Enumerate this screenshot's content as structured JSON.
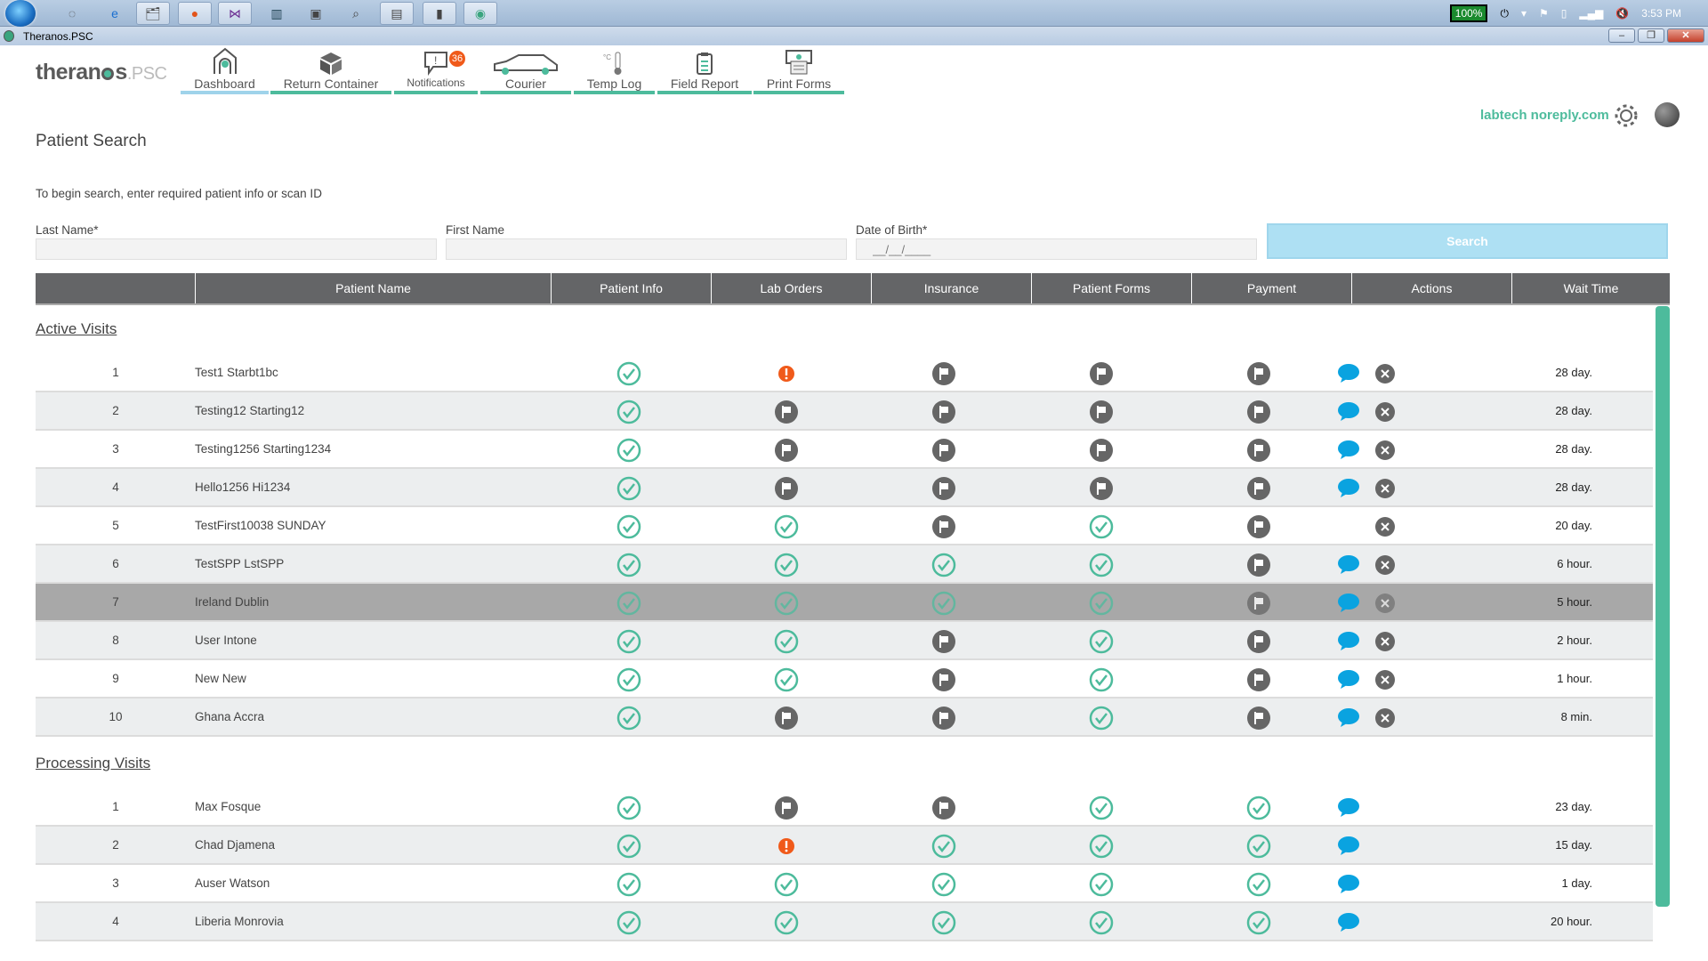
{
  "taskbar": {
    "battery": "100%",
    "clock": "3:53 PM"
  },
  "window": {
    "title": "Theranos.PSC"
  },
  "brand": {
    "name": "theranos",
    "suffix": "PSC"
  },
  "nav": {
    "tabs": [
      {
        "label": "Dashboard",
        "icon": "home-icon",
        "active": true
      },
      {
        "label": "Return Container",
        "icon": "box-icon"
      },
      {
        "label": "Notifications",
        "icon": "speech-bubble-icon",
        "badge": "36"
      },
      {
        "label": "Courier",
        "icon": "car-icon"
      },
      {
        "label": "Temp Log",
        "icon": "thermometer-icon"
      },
      {
        "label": "Field Report",
        "icon": "clipboard-icon"
      },
      {
        "label": "Print Forms",
        "icon": "printer-icon"
      }
    ],
    "user": "labtech noreply.com"
  },
  "search": {
    "title": "Patient Search",
    "hint": "To begin search, enter required patient info or scan ID",
    "last_name_label": "Last Name*",
    "first_name_label": "First Name",
    "dob_label": "Date of Birth*",
    "dob_placeholder": "__/__/____",
    "button": "Search"
  },
  "table": {
    "columns": [
      "",
      "Patient Name",
      "Patient Info",
      "Lab Orders",
      "Insurance",
      "Patient Forms",
      "Payment",
      "Actions",
      "Wait Time"
    ]
  },
  "colors": {
    "accent": "#4dbb9c",
    "alert": "#f05a1a",
    "chat": "#0aa3e0",
    "flag": "#666666",
    "header": "#646567"
  },
  "sections": [
    {
      "title": "Active Visits",
      "rows": [
        {
          "num": "1",
          "name": "Test1 Starbt1bc",
          "status": [
            "check",
            "alert",
            "flag",
            "flag",
            "flag"
          ],
          "chat": true,
          "cancel": true,
          "wait": "28 day."
        },
        {
          "num": "2",
          "name": "Testing12 Starting12",
          "status": [
            "check",
            "flag",
            "flag",
            "flag",
            "flag"
          ],
          "chat": true,
          "cancel": true,
          "wait": "28 day."
        },
        {
          "num": "3",
          "name": "Testing1256 Starting1234",
          "status": [
            "check",
            "flag",
            "flag",
            "flag",
            "flag"
          ],
          "chat": true,
          "cancel": true,
          "wait": "28 day."
        },
        {
          "num": "4",
          "name": "Hello1256 Hi1234",
          "status": [
            "check",
            "flag",
            "flag",
            "flag",
            "flag"
          ],
          "chat": true,
          "cancel": true,
          "wait": "28 day."
        },
        {
          "num": "5",
          "name": "TestFirst10038 SUNDAY",
          "status": [
            "check",
            "check",
            "flag",
            "check",
            "flag"
          ],
          "chat": false,
          "cancel": true,
          "wait": "20 day."
        },
        {
          "num": "6",
          "name": "TestSPP LstSPP",
          "status": [
            "check",
            "check",
            "check",
            "check",
            "flag"
          ],
          "chat": true,
          "cancel": true,
          "wait": "6 hour."
        },
        {
          "num": "7",
          "name": "Ireland Dublin",
          "status": [
            "check",
            "check",
            "check",
            "check",
            "flag"
          ],
          "chat": true,
          "cancel": true,
          "wait": "5 hour.",
          "highlighted": true
        },
        {
          "num": "8",
          "name": "User Intone",
          "status": [
            "check",
            "check",
            "flag",
            "check",
            "flag"
          ],
          "chat": true,
          "cancel": true,
          "wait": "2 hour."
        },
        {
          "num": "9",
          "name": "New New",
          "status": [
            "check",
            "check",
            "flag",
            "check",
            "flag"
          ],
          "chat": true,
          "cancel": true,
          "wait": "1 hour."
        },
        {
          "num": "10",
          "name": "Ghana Accra",
          "status": [
            "check",
            "flag",
            "flag",
            "check",
            "flag"
          ],
          "chat": true,
          "cancel": true,
          "wait": "8 min."
        }
      ]
    },
    {
      "title": "Processing Visits",
      "rows": [
        {
          "num": "1",
          "name": "Max Fosque",
          "status": [
            "check",
            "flag",
            "flag",
            "check",
            "check"
          ],
          "chat": true,
          "cancel": false,
          "wait": "23 day."
        },
        {
          "num": "2",
          "name": "Chad Djamena",
          "status": [
            "check",
            "alert",
            "check",
            "check",
            "check"
          ],
          "chat": true,
          "cancel": false,
          "wait": "15 day."
        },
        {
          "num": "3",
          "name": "Auser Watson",
          "status": [
            "check",
            "check",
            "check",
            "check",
            "check"
          ],
          "chat": true,
          "cancel": false,
          "wait": "1 day."
        },
        {
          "num": "4",
          "name": "Liberia Monrovia",
          "status": [
            "check",
            "check",
            "check",
            "check",
            "check"
          ],
          "chat": true,
          "cancel": false,
          "wait": "20 hour."
        }
      ]
    }
  ]
}
